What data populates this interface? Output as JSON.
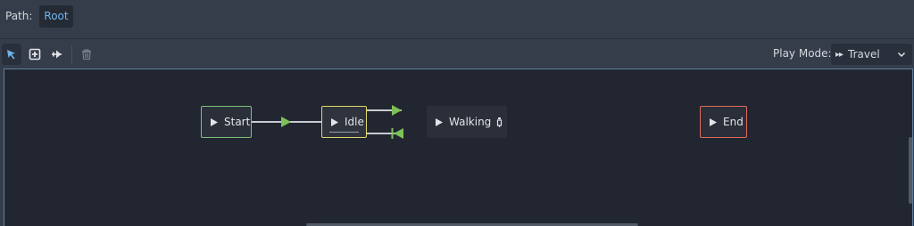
{
  "path": {
    "label": "Path:",
    "root": "Root"
  },
  "toolbar": {
    "tools": [
      {
        "name": "select",
        "icon": "pointer-arrow-icon",
        "active": true
      },
      {
        "name": "create",
        "icon": "add-node-icon",
        "active": false
      },
      {
        "name": "connect",
        "icon": "connect-icon",
        "active": false
      },
      {
        "name": "delete",
        "icon": "trash-icon",
        "active": false
      }
    ],
    "play_mode_label": "Play Mode:",
    "play_mode_icon": "▸▸",
    "play_mode_value": "Travel"
  },
  "nodes": {
    "start": "Start",
    "idle": "Idle",
    "walking": "Walking",
    "end": "End"
  },
  "colors": {
    "start_border": "#7fc17a",
    "idle_border": "#dfd869",
    "end_border": "#e3695c",
    "transition_arrow": "#7ec057",
    "accent": "#6eb3f0"
  }
}
